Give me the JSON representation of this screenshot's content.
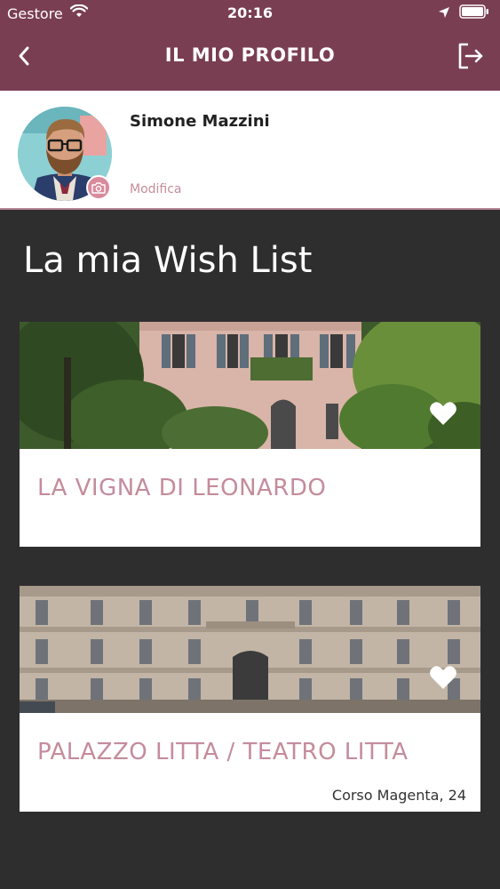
{
  "status_bar": {
    "carrier": "Gestore",
    "time": "20:16"
  },
  "header": {
    "title": "IL MIO PROFILO"
  },
  "profile": {
    "name": "Simone Mazzini",
    "edit_label": "Modifica"
  },
  "wishlist": {
    "title": "La mia Wish List",
    "items": [
      {
        "title": "LA VIGNA DI LEONARDO",
        "address": ""
      },
      {
        "title": "PALAZZO LITTA / TEATRO LITTA",
        "address": "Corso Magenta, 24"
      }
    ]
  },
  "colors": {
    "header_bg": "#7a3e52",
    "page_bg": "#2f2e2f",
    "accent_pink": "#c48c9c"
  }
}
